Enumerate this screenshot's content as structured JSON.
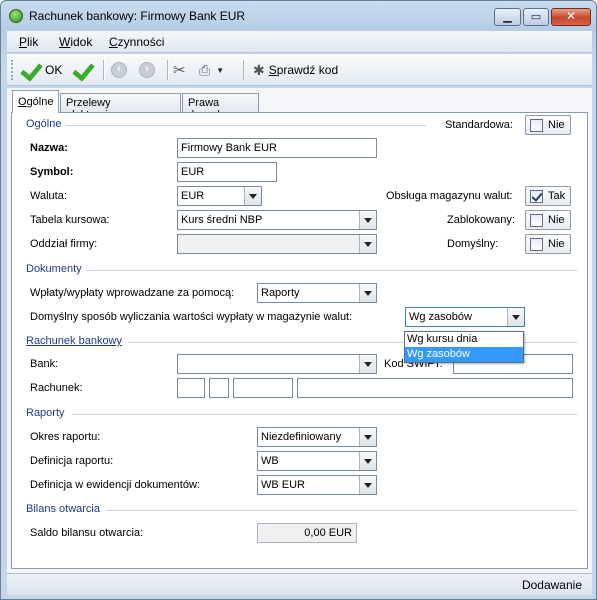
{
  "window": {
    "title": "Rachunek bankowy: Firmowy Bank EUR"
  },
  "menu": [
    {
      "pre": "",
      "key": "P",
      "post": "lik"
    },
    {
      "pre": "",
      "key": "W",
      "post": "idok"
    },
    {
      "pre": "",
      "key": "C",
      "post": "zynności"
    }
  ],
  "toolbar": {
    "ok_label": "OK",
    "verify_label": "Sprawdź kod",
    "verify_key": "S",
    "verify_rest": "prawdź kod"
  },
  "tabs": [
    {
      "key": "O",
      "rest": "gólne"
    },
    {
      "label": "Przelewy elektroniczne"
    },
    {
      "label": "Prawa danych"
    }
  ],
  "general": {
    "section_title": "Ogólne",
    "standard_label": "Standardowa:",
    "standard_value": "Nie",
    "name_label": "Nazwa:",
    "name_value": "Firmowy Bank EUR",
    "symbol_label": "Symbol:",
    "symbol_value": "EUR",
    "currency_label": "Waluta:",
    "currency_value": "EUR",
    "currency_warehouse_label": "Obsługa magazynu walut:",
    "currency_warehouse_value": "Tak",
    "rate_table_label": "Tabela kursowa:",
    "rate_table_value": "Kurs średni NBP",
    "blocked_label": "Zablokowany:",
    "blocked_value": "Nie",
    "branch_label": "Oddział firmy:",
    "branch_value": "",
    "default_label": "Domyślny:",
    "default_value": "Nie"
  },
  "documents": {
    "section_title": "Dokumenty",
    "payments_label": "Wpłaty/wypłaty wprowadzane za pomocą:",
    "payments_value": "Raporty",
    "calc_label": "Domyślny sposób wyliczania wartości wypłaty w magazynie walut:",
    "calc_value": "Wg zasobów",
    "calc_options": [
      "Wg kursu dnia",
      "Wg zasobów"
    ]
  },
  "bank_account": {
    "section_title": "Rachunek bankowy",
    "bank_label": "Bank:",
    "bank_value": "",
    "swift_label": "Kod SWIFT:",
    "swift_value": "",
    "account_label": "Rachunek:"
  },
  "reports": {
    "section_title": "Raporty",
    "period_label": "Okres raportu:",
    "period_value": "Niezdefiniowany",
    "definition_label": "Definicja raportu:",
    "definition_value": "WB",
    "doc_definition_label": "Definicja w ewidencji dokumentów:",
    "doc_definition_value": "WB EUR"
  },
  "opening": {
    "section_title": "Bilans otwarcia",
    "balance_label": "Saldo bilansu otwarcia:",
    "balance_value": "0,00 EUR"
  },
  "status": {
    "mode": "Dodawanie"
  }
}
